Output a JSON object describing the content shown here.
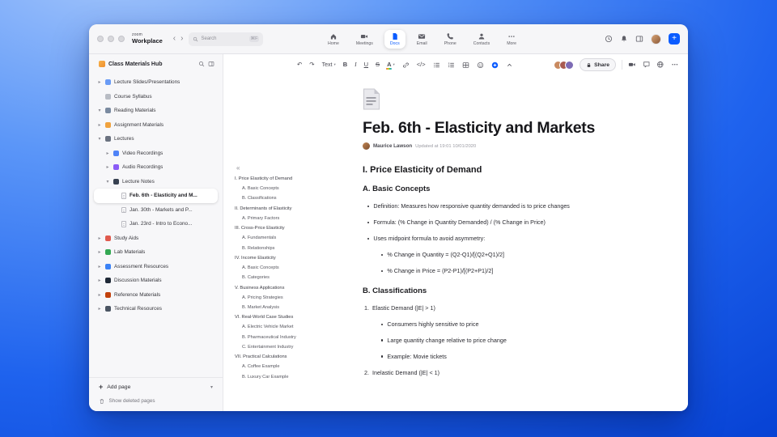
{
  "colors": {
    "accent": "#0B5CFF"
  },
  "titlebar": {
    "brand_top": "zoom",
    "brand_bottom": "Workplace",
    "search_placeholder": "Search",
    "search_shortcut": "⌘F",
    "tabs": [
      {
        "label": "Home",
        "icon": "home-icon",
        "active": false
      },
      {
        "label": "Meetings",
        "icon": "meetings-icon",
        "active": false
      },
      {
        "label": "Docs",
        "icon": "docs-icon",
        "active": true
      },
      {
        "label": "Email",
        "icon": "email-icon",
        "active": false
      },
      {
        "label": "Phone",
        "icon": "phone-icon",
        "active": false
      },
      {
        "label": "Contacts",
        "icon": "contacts-icon",
        "active": false
      },
      {
        "label": "More",
        "icon": "more-icon",
        "active": false
      }
    ],
    "right_items": [
      {
        "name": "history",
        "icon": "clock-icon"
      },
      {
        "name": "notifications",
        "icon": "bell-icon"
      },
      {
        "name": "layout",
        "icon": "panel-icon"
      }
    ]
  },
  "sidebar": {
    "title": "Class Materials Hub",
    "add_page": "Add page",
    "show_deleted": "Show deleted pages",
    "tree": [
      {
        "label": "Lecture Slides/Presentations",
        "icon": "slides-icon",
        "icon_color": "#6A9BF5",
        "level": 0,
        "chevron": "right",
        "selected": false
      },
      {
        "label": "Course Syllabus",
        "icon": "syllabus-icon",
        "icon_color": "#B8BCC4",
        "level": 0,
        "chevron": "none",
        "selected": false
      },
      {
        "label": "Reading Materials",
        "icon": "reading-icon",
        "icon_color": "#7A8AA0",
        "level": 0,
        "chevron": "down",
        "selected": false
      },
      {
        "label": "Assignment Materials",
        "icon": "assignment-icon",
        "icon_color": "#F0A23E",
        "level": 0,
        "chevron": "right",
        "selected": false
      },
      {
        "label": "Lectures",
        "icon": "lectures-icon",
        "icon_color": "#6B7280",
        "level": 0,
        "chevron": "down",
        "selected": false
      },
      {
        "label": "Video Recordings",
        "icon": "video-icon",
        "icon_color": "#4F83F7",
        "level": 1,
        "chevron": "right",
        "selected": false
      },
      {
        "label": "Audio Recordings",
        "icon": "audio-icon",
        "icon_color": "#8B5CF6",
        "level": 1,
        "chevron": "right",
        "selected": false
      },
      {
        "label": "Lecture Notes",
        "icon": "notes-icon",
        "icon_color": "#374151",
        "level": 1,
        "chevron": "down",
        "selected": false
      },
      {
        "label": "Feb. 6th - Elasticity and M...",
        "icon": "page-icon",
        "icon_type": "page",
        "level": 2,
        "chevron": "none",
        "selected": true
      },
      {
        "label": "Jan. 30th - Markets and P...",
        "icon": "page-icon",
        "icon_type": "page",
        "level": 2,
        "chevron": "none",
        "selected": false
      },
      {
        "label": "Jan. 23rd - Intro to Econo...",
        "icon": "page-icon",
        "icon_type": "page",
        "level": 2,
        "chevron": "none",
        "selected": false
      },
      {
        "label": "Study Aids",
        "icon": "study-aids-icon",
        "icon_color": "#E05A4E",
        "level": 0,
        "chevron": "right",
        "selected": false
      },
      {
        "label": "Lab Materials",
        "icon": "lab-icon",
        "icon_color": "#34A853",
        "level": 0,
        "chevron": "right",
        "selected": false
      },
      {
        "label": "Assessment Resources",
        "icon": "assessment-icon",
        "icon_color": "#3B82F6",
        "level": 0,
        "chevron": "right",
        "selected": false
      },
      {
        "label": "Discussion Materials",
        "icon": "discussion-icon",
        "icon_color": "#1F2937",
        "level": 0,
        "chevron": "right",
        "selected": false
      },
      {
        "label": "Reference Materials",
        "icon": "reference-icon",
        "icon_color": "#C2410C",
        "level": 0,
        "chevron": "right",
        "selected": false
      },
      {
        "label": "Technical Resources",
        "icon": "technical-icon",
        "icon_color": "#4B5563",
        "level": 0,
        "chevron": "right",
        "selected": false
      }
    ]
  },
  "doc_toolbar": {
    "share_label": "Share",
    "collaborator_colors": [
      "#C98A60",
      "#A85B50",
      "#7D6BB5"
    ],
    "items": [
      {
        "name": "undo",
        "glyph": "↶"
      },
      {
        "name": "redo",
        "glyph": "↷"
      },
      {
        "name": "text-style",
        "label": "Text",
        "dropdown": true
      },
      {
        "name": "bold",
        "glyph": "B",
        "style": "bold"
      },
      {
        "name": "italic",
        "glyph": "I",
        "style": "italic"
      },
      {
        "name": "underline",
        "glyph": "U",
        "style": "underline"
      },
      {
        "name": "strikethrough",
        "glyph": "S",
        "style": "strike"
      },
      {
        "name": "text-color",
        "glyph": "A",
        "style": "color",
        "dropdown": true
      },
      {
        "name": "link",
        "icon": "link-icon"
      },
      {
        "name": "code",
        "glyph": "</>"
      },
      {
        "name": "bulleted-list",
        "icon": "list-icon"
      },
      {
        "name": "numbered-list",
        "icon": "numlist-icon"
      },
      {
        "name": "table",
        "icon": "table-icon"
      },
      {
        "name": "emoji",
        "icon": "emoji-icon"
      },
      {
        "name": "insert",
        "icon": "plus-icon",
        "accent": true
      },
      {
        "name": "collapse-toolbar",
        "icon": "chevron-up-icon"
      }
    ],
    "right_items": [
      {
        "name": "video",
        "icon": "camera-icon"
      },
      {
        "name": "comments",
        "icon": "comment-icon"
      },
      {
        "name": "language",
        "icon": "globe-icon"
      },
      {
        "name": "more-options",
        "icon": "more-dots-icon"
      }
    ]
  },
  "document": {
    "title": "Feb. 6th - Elasticity and Markets",
    "author": "Maurice Lawson",
    "updated": "Updated at 19:01 10/01/2020",
    "outline_collapse": "«",
    "outline": [
      {
        "text": "I. Price Elasticity of Demand",
        "level": 0
      },
      {
        "text": "A. Basic Concepts",
        "level": 1
      },
      {
        "text": "B. Classifications",
        "level": 1
      },
      {
        "text": "II. Determinants of Elasticity",
        "level": 0
      },
      {
        "text": "A. Primary Factors",
        "level": 1
      },
      {
        "text": "III. Cross-Price Elasticity",
        "level": 0
      },
      {
        "text": "A. Fundamentals",
        "level": 1
      },
      {
        "text": "B. Relationships",
        "level": 1
      },
      {
        "text": "IV. Income Elasticity",
        "level": 0
      },
      {
        "text": "A. Basic Concepts",
        "level": 1
      },
      {
        "text": "B. Categories",
        "level": 1
      },
      {
        "text": "V. Business Applications",
        "level": 0
      },
      {
        "text": "A. Pricing Strategies",
        "level": 1
      },
      {
        "text": "B. Market Analysis",
        "level": 1
      },
      {
        "text": "VI. Real-World Case Studies",
        "level": 0
      },
      {
        "text": "A. Electric Vehicle Market",
        "level": 1
      },
      {
        "text": "B. Pharmaceutical Industry",
        "level": 1
      },
      {
        "text": "C. Entertainment Industry",
        "level": 1
      },
      {
        "text": "VII. Practical Calculations",
        "level": 0
      },
      {
        "text": "A. Coffee Example",
        "level": 1
      },
      {
        "text": "B. Luxury Car Example",
        "level": 1
      }
    ],
    "body": [
      {
        "type": "h2",
        "text": "I. Price Elasticity of Demand"
      },
      {
        "type": "h3",
        "text": "A. Basic Concepts"
      },
      {
        "type": "bullet",
        "level": 0,
        "text": "Definition: Measures how responsive quantity demanded is to price changes"
      },
      {
        "type": "bullet",
        "level": 0,
        "text": "Formula: (% Change in Quantity Demanded) / (% Change in Price)"
      },
      {
        "type": "bullet",
        "level": 0,
        "text": "Uses midpoint formula to avoid asymmetry:"
      },
      {
        "type": "bullet",
        "level": 1,
        "text": "% Change in Quantity = (Q2-Q1)/[(Q2+Q1)/2]"
      },
      {
        "type": "bullet",
        "level": 1,
        "text": "% Change in Price = (P2-P1)/[(P2+P1)/2]"
      },
      {
        "type": "h3",
        "text": "B. Classifications"
      },
      {
        "type": "number",
        "num": "1.",
        "text": "Elastic Demand (|E| > 1)"
      },
      {
        "type": "bullet",
        "level": 1,
        "text": "Consumers highly sensitive to price"
      },
      {
        "type": "bullet",
        "level": 1,
        "text": "Large quantity change relative to price change"
      },
      {
        "type": "bullet",
        "level": 1,
        "text": "Example: Movie tickets"
      },
      {
        "type": "number",
        "num": "2.",
        "text": "Inelastic Demand (|E| < 1)"
      }
    ]
  }
}
